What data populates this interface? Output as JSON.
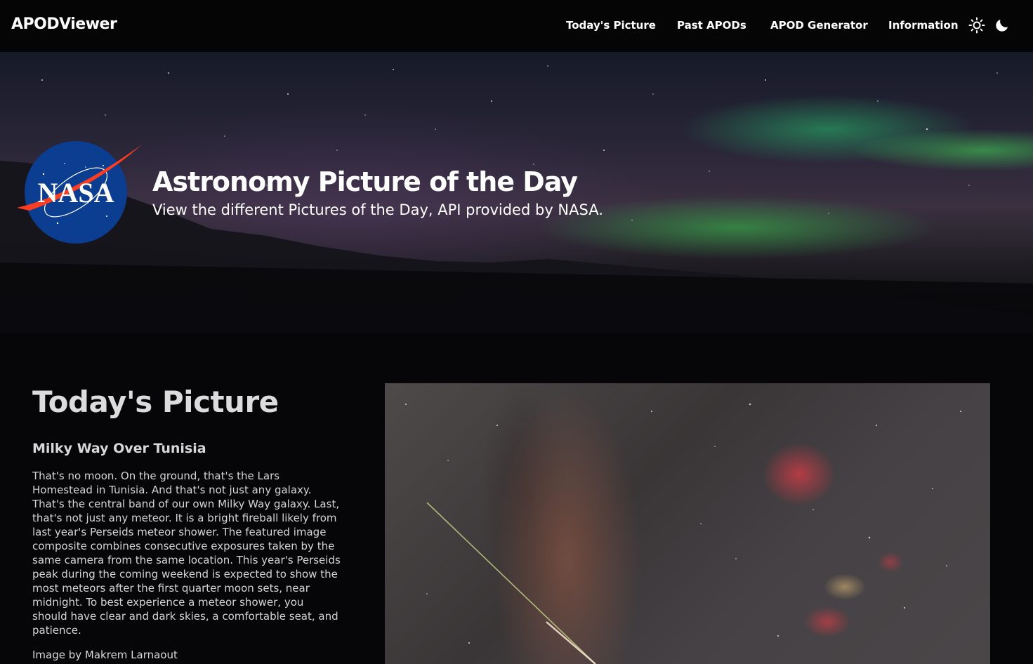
{
  "navbar": {
    "brand": "APODViewer",
    "links": [
      "Today's Picture",
      "Past APODs",
      "APOD Generator",
      "Information"
    ],
    "theme_icons": [
      "sun-icon",
      "moon-icon"
    ]
  },
  "hero": {
    "logo_text": "NASA",
    "title": "Astronomy Picture of the Day",
    "subtitle": "View the different Pictures of the Day, API provided by NASA."
  },
  "today": {
    "section_title": "Today's Picture",
    "apod_title": "Milky Way Over Tunisia",
    "description": "That's no moon. On the ground, that's the Lars Homestead in Tunisia. And that's not just any galaxy. That's the central band of our own Milky Way galaxy. Last, that's not just any meteor. It is a bright fireball likely from last year's Perseids meteor shower. The featured image composite combines consecutive exposures taken by the same camera from the same location. This year's Perseids peak during the coming weekend is expected to show the most meteors after the first quarter moon sets, near midnight. To best experience a meteor shower, you should have clear and dark skies, a comfortable seat, and patience.",
    "credit": "Image by Makrem Larnaout"
  },
  "colors": {
    "navbar_bg": "#050505",
    "page_bg": "#060608",
    "nasa_blue": "#0b3d91",
    "nasa_red": "#fc3d21",
    "aurora_green": "#2ecc71"
  }
}
